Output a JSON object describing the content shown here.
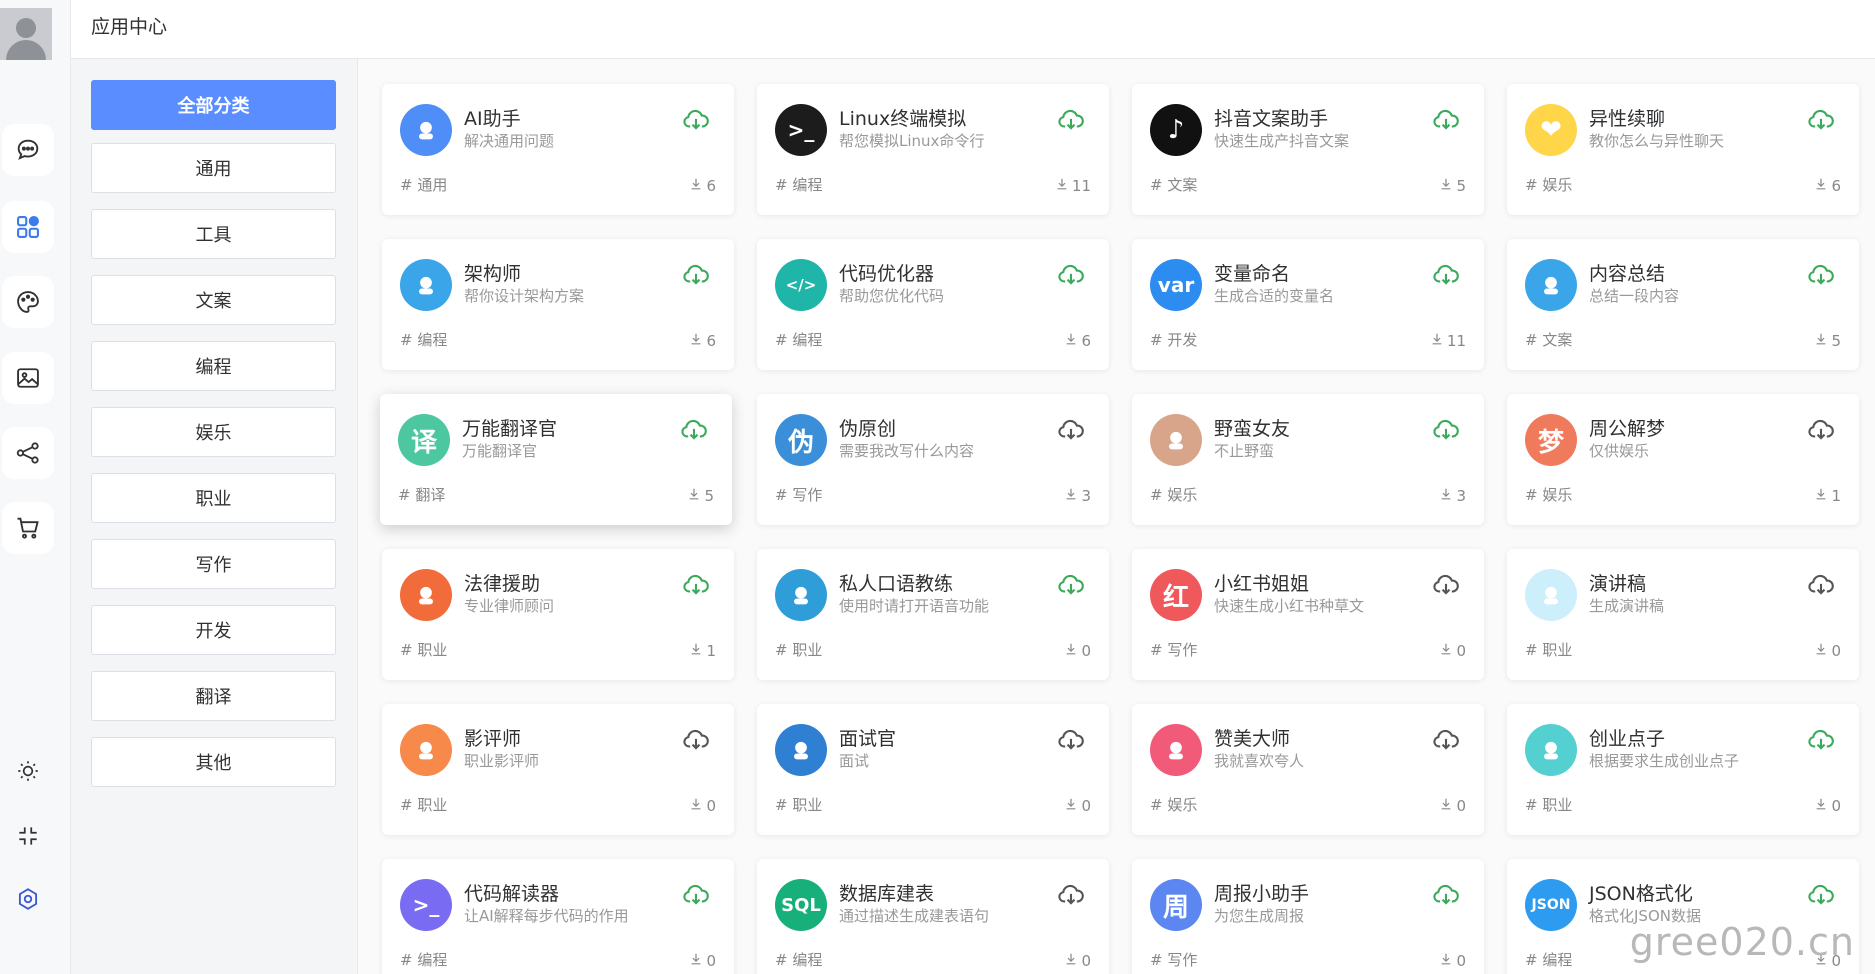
{
  "header": {
    "title": "应用中心"
  },
  "categories": [
    "全部分类",
    "通用",
    "工具",
    "文案",
    "编程",
    "娱乐",
    "职业",
    "写作",
    "开发",
    "翻译",
    "其他"
  ],
  "active_category": "全部分类",
  "rail_icons": [
    "chat-icon",
    "apps-icon",
    "palette-icon",
    "image-icon",
    "share-icon",
    "cart-icon",
    "sun-icon",
    "collapse-icon",
    "settings-icon"
  ],
  "apps": [
    {
      "name": "AI助手",
      "desc": "解决通用问题",
      "tag": "# 通用",
      "count": "6",
      "icon": "robot-icon",
      "color": "#4f8ef7",
      "glyph": "",
      "installed": true
    },
    {
      "name": "Linux终端模拟",
      "desc": "帮您模拟Linux命令行",
      "tag": "# 编程",
      "count": "11",
      "icon": "terminal-icon",
      "color": "#1c1c1c",
      "glyph": ">_",
      "installed": true
    },
    {
      "name": "抖音文案助手",
      "desc": "快速生成产抖音文案",
      "tag": "# 文案",
      "count": "5",
      "icon": "tiktok-icon",
      "color": "#111111",
      "glyph": "♪",
      "installed": true
    },
    {
      "name": "异性续聊",
      "desc": "教你怎么与异性聊天",
      "tag": "# 娱乐",
      "count": "6",
      "icon": "hearts-icon",
      "color": "#ffd54a",
      "glyph": "❤",
      "installed": true
    },
    {
      "name": "架构师",
      "desc": "帮你设计架构方案",
      "tag": "# 编程",
      "count": "6",
      "icon": "architect-icon",
      "color": "#3aa5e8",
      "glyph": "",
      "installed": true
    },
    {
      "name": "代码优化器",
      "desc": "帮助您优化代码",
      "tag": "# 编程",
      "count": "6",
      "icon": "code-icon",
      "color": "#1fb5a8",
      "glyph": "</>",
      "installed": true
    },
    {
      "name": "变量命名",
      "desc": "生成合适的变量名",
      "tag": "# 开发",
      "count": "11",
      "icon": "var-icon",
      "color": "#2d8cf0",
      "glyph": "var",
      "installed": true
    },
    {
      "name": "内容总结",
      "desc": "总结一段内容",
      "tag": "# 文案",
      "count": "5",
      "icon": "summary-icon",
      "color": "#3aa5e8",
      "glyph": "",
      "installed": true
    },
    {
      "name": "万能翻译官",
      "desc": "万能翻译官",
      "tag": "# 翻译",
      "count": "5",
      "icon": "translate-icon",
      "color": "#4cc7a0",
      "glyph": "译",
      "installed": true
    },
    {
      "name": "伪原创",
      "desc": "需要我改写什么内容",
      "tag": "# 写作",
      "count": "3",
      "icon": "rewrite-icon",
      "color": "#3b8fd9",
      "glyph": "伪",
      "installed": false
    },
    {
      "name": "野蛮女友",
      "desc": "不止野蛮",
      "tag": "# 娱乐",
      "count": "3",
      "icon": "girl-avatar-icon",
      "color": "#d9a58a",
      "glyph": "",
      "installed": true
    },
    {
      "name": "周公解梦",
      "desc": "仅供娱乐",
      "tag": "# 娱乐",
      "count": "1",
      "icon": "dream-icon",
      "color": "#f07a5c",
      "glyph": "梦",
      "installed": false
    },
    {
      "name": "法律援助",
      "desc": "专业律师顾问",
      "tag": "# 职业",
      "count": "1",
      "icon": "gavel-icon",
      "color": "#f26b3a",
      "glyph": "",
      "installed": true
    },
    {
      "name": "私人口语教练",
      "desc": "使用时请打开语音功能",
      "tag": "# 职业",
      "count": "0",
      "icon": "coach-avatar-icon",
      "color": "#2f9ed8",
      "glyph": "",
      "installed": true
    },
    {
      "name": "小红书姐姐",
      "desc": "快速生成小红书种草文",
      "tag": "# 写作",
      "count": "0",
      "icon": "redbook-icon",
      "color": "#f0595b",
      "glyph": "红",
      "installed": false
    },
    {
      "name": "演讲稿",
      "desc": "生成演讲稿",
      "tag": "# 职业",
      "count": "0",
      "icon": "microphone-icon",
      "color": "#cdeefb",
      "glyph": "",
      "installed": false
    },
    {
      "name": "影评师",
      "desc": "职业影评师",
      "tag": "# 职业",
      "count": "0",
      "icon": "film-reel-icon",
      "color": "#f7894a",
      "glyph": "",
      "installed": false
    },
    {
      "name": "面试官",
      "desc": "面试",
      "tag": "# 职业",
      "count": "0",
      "icon": "tie-icon",
      "color": "#2f7fd2",
      "glyph": "",
      "installed": false
    },
    {
      "name": "赞美大师",
      "desc": "我就喜欢夸人",
      "tag": "# 娱乐",
      "count": "0",
      "icon": "thumbs-up-icon",
      "color": "#f25a7a",
      "glyph": "",
      "installed": false
    },
    {
      "name": "创业点子",
      "desc": "根据要求生成创业点子",
      "tag": "# 职业",
      "count": "0",
      "icon": "idea-icon",
      "color": "#55d0d0",
      "glyph": "",
      "installed": true
    },
    {
      "name": "代码解读器",
      "desc": "让AI解释每步代码的作用",
      "tag": "# 编程",
      "count": "0",
      "icon": "code-reader-icon",
      "color": "#7a6cf2",
      "glyph": ">_",
      "installed": true
    },
    {
      "name": "数据库建表",
      "desc": "通过描述生成建表语句",
      "tag": "# 编程",
      "count": "0",
      "icon": "sql-icon",
      "color": "#18b07a",
      "glyph": "SQL",
      "installed": false
    },
    {
      "name": "周报小助手",
      "desc": "为您生成周报",
      "tag": "# 写作",
      "count": "0",
      "icon": "weekly-report-icon",
      "color": "#5c86f0",
      "glyph": "周",
      "installed": true
    },
    {
      "name": "JSON格式化",
      "desc": "格式化JSON数据",
      "tag": "# 编程",
      "count": "0",
      "icon": "json-icon",
      "color": "#2d9cf0",
      "glyph": "JSON",
      "installed": true
    }
  ],
  "watermark": "gree020.cn",
  "colors": {
    "accent": "#5a8dff",
    "installed": "#3aaa5a",
    "not_installed": "#555555"
  }
}
